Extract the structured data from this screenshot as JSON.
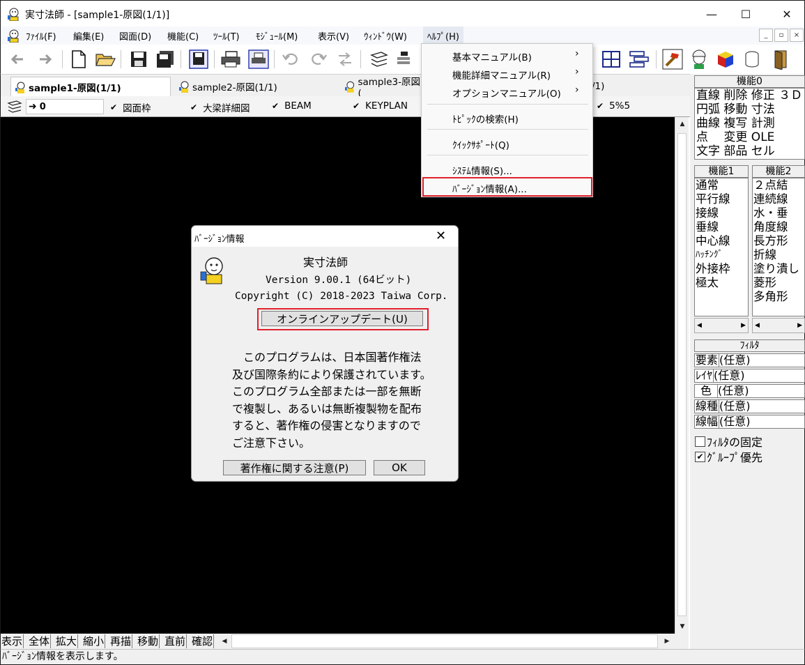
{
  "window": {
    "title": "実寸法師 - [sample1-原図(1/1)]",
    "minimize_glyph": "—",
    "maximize_glyph": "☐",
    "close_glyph": "✕"
  },
  "menubar": {
    "items": [
      "ﾌｧｲﾙ(F)",
      "編集(E)",
      "図面(D)",
      "機能(C)",
      "ﾂｰﾙ(T)",
      "ﾓｼﾞｭｰﾙ(M)",
      "表示(V)",
      "ｳｨﾝﾄﾞｳ(W)",
      "ﾍﾙﾌﾟ(H)"
    ],
    "mdi_min": "_",
    "mdi_restore": "▫",
    "mdi_close": "×"
  },
  "tabs": [
    "sample1-原図(1/1)",
    "sample2-原図(1/1)",
    "sample3-原図(",
    "/1)"
  ],
  "layerbar": {
    "current_layer": "0",
    "layers": [
      "図面枠",
      "大梁詳細図",
      "BEAM",
      "KEYPLAN",
      "5%5"
    ],
    "tick": "✔"
  },
  "help_menu": {
    "items": [
      {
        "label": "基本マニュアル(B)",
        "submenu": true
      },
      {
        "label": "機能詳細マニュアル(R)",
        "submenu": true
      },
      {
        "label": "オプションマニュアル(O)",
        "submenu": true
      },
      {
        "label": "ﾄﾋﾟｯｸの検索(H)",
        "submenu": false
      },
      {
        "label": "ｸｲｯｸｻﾎﾟｰﾄ(Q)",
        "submenu": false
      },
      {
        "label": "ｼｽﾃﾑ情報(S)...",
        "submenu": false
      },
      {
        "label": "ﾊﾞｰｼﾞｮﾝ情報(A)...",
        "submenu": false
      }
    ],
    "submenu_arrow": "›"
  },
  "about_dialog": {
    "title": "ﾊﾞｰｼﾞｮﾝ情報",
    "close_glyph": "✕",
    "app_name": "実寸法師",
    "version": "Version 9.00.1 (64ビット)",
    "copyright": "Copyright (C) 2018-2023 Taiwa Corp.",
    "update_button": "オンラインアップデート(U)",
    "notice": [
      "　このプログラムは、日本国著作権法",
      "及び国際条約により保護されています。",
      "このプログラム全部または一部を無断",
      "で複製し、あるいは無断複製物を配布",
      "すると、著作権の侵害となりますので",
      "ご注意下さい。"
    ],
    "copyright_notice_button": "著作権に関する注意(P)",
    "ok_button": "OK"
  },
  "right_panel": {
    "func0_title": "機能0",
    "func0_rows": [
      "直線 削除 修正 ３Ｄ",
      "円弧 移動 寸法",
      "曲線 複写 計測",
      "点　 変更 OLE",
      "文字 部品 セル"
    ],
    "func1_title": "機能1",
    "func1_items": [
      "通常",
      "平行線",
      "接線",
      "垂線",
      "中心線",
      "ﾊｯﾁﾝｸﾞ",
      "外接枠",
      "極太"
    ],
    "func2_title": "機能2",
    "func2_items": [
      "２点結",
      "連続線",
      "水・垂",
      "角度線",
      "長方形",
      "折線",
      "塗り潰し",
      "菱形",
      "多角形"
    ],
    "filter_title": "ﾌｨﾙﾀ",
    "filters": [
      {
        "label": "要素",
        "value": "(任意)"
      },
      {
        "label": "ﾚｲﾔ",
        "value": "(任意)"
      },
      {
        "label": "色",
        "value": "(任意)"
      },
      {
        "label": "線種",
        "value": "(任意)"
      },
      {
        "label": "線幅",
        "value": "(任意)"
      }
    ],
    "filter_fix_label": "ﾌｨﾙﾀの固定",
    "filter_fix_checked": false,
    "group_priority_label": "ｸﾞﾙｰﾌﾟ優先",
    "group_priority_checked": true,
    "check_glyph": "✔"
  },
  "bottom_buttons": [
    "表示",
    "全体",
    "拡大",
    "縮小",
    "再描",
    "移動",
    "直前",
    "確認"
  ],
  "status_text": "ﾊﾞｰｼﾞｮﾝ情報を表示します。",
  "colors": {
    "highlight_red": "#e0202c",
    "canvas": "#000000",
    "dialog_bg": "#f0f0f0"
  }
}
